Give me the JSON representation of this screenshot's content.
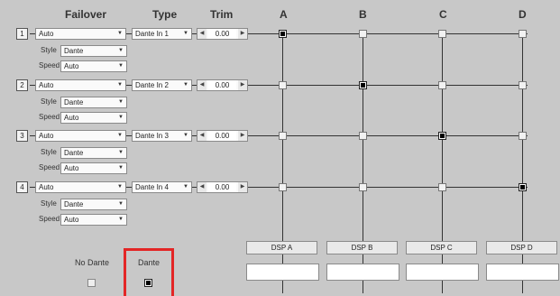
{
  "headers": {
    "failover": "Failover",
    "type": "Type",
    "trim": "Trim",
    "cols": [
      "A",
      "B",
      "C",
      "D"
    ]
  },
  "rows": [
    {
      "num": "1",
      "failover": "Auto",
      "type": "Dante In 1",
      "trim": "0.00",
      "style_label": "Style",
      "style": "Dante",
      "speed_label": "Speed",
      "speed": "Auto",
      "selected_col": 0
    },
    {
      "num": "2",
      "failover": "Auto",
      "type": "Dante In 2",
      "trim": "0.00",
      "style_label": "Style",
      "style": "Dante",
      "speed_label": "Speed",
      "speed": "Auto",
      "selected_col": 1
    },
    {
      "num": "3",
      "failover": "Auto",
      "type": "Dante In 3",
      "trim": "0.00",
      "style_label": "Style",
      "style": "Dante",
      "speed_label": "Speed",
      "speed": "Auto",
      "selected_col": 2
    },
    {
      "num": "4",
      "failover": "Auto",
      "type": "Dante In 4",
      "trim": "0.00",
      "style_label": "Style",
      "style": "Dante",
      "speed_label": "Speed",
      "speed": "Auto",
      "selected_col": 3
    }
  ],
  "dsp": [
    "DSP A",
    "DSP B",
    "DSP C",
    "DSP D"
  ],
  "bottom": {
    "no_dante_label": "No Dante",
    "no_dante_checked": false,
    "dante_label": "Dante",
    "dante_checked": true
  },
  "colors": {
    "highlight": "#e32626"
  },
  "icons": {
    "dropdown": "chevron-down-icon",
    "decrement": "triangle-left-icon",
    "increment": "triangle-right-icon"
  }
}
